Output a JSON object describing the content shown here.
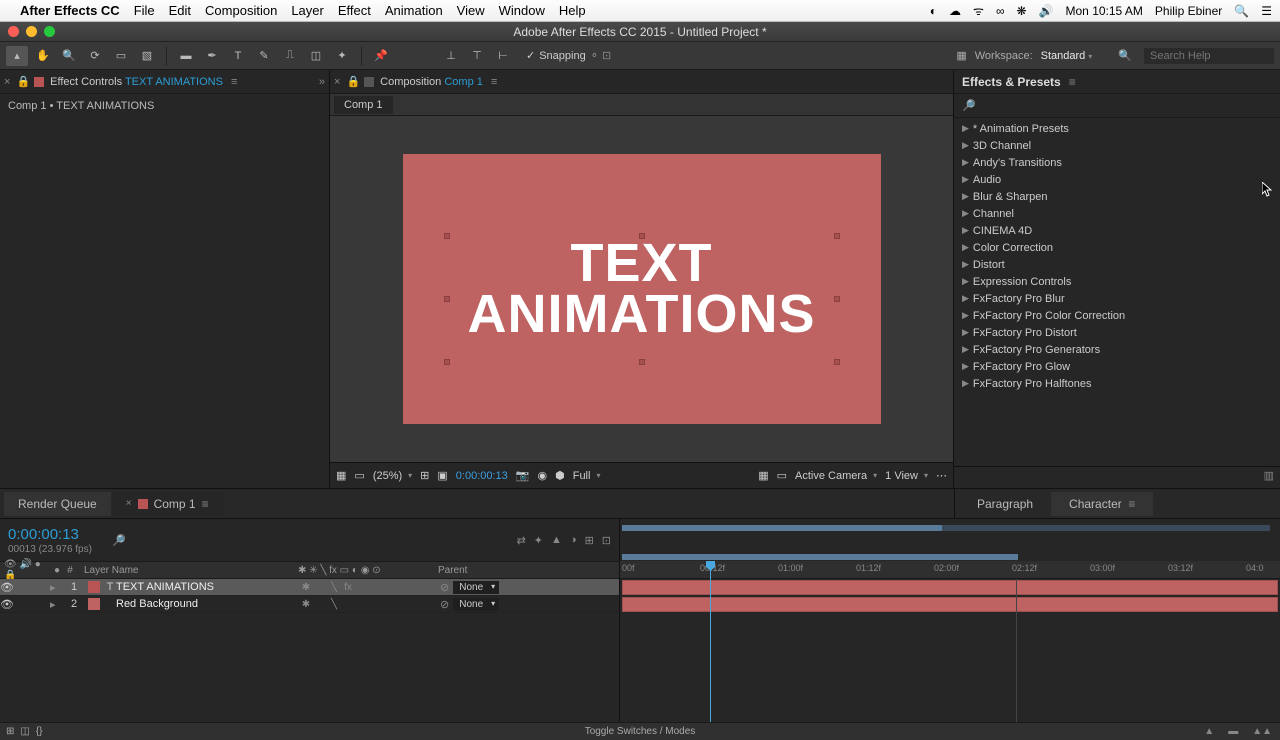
{
  "menubar": {
    "app": "After Effects CC",
    "items": [
      "File",
      "Edit",
      "Composition",
      "Layer",
      "Effect",
      "Animation",
      "View",
      "Window",
      "Help"
    ],
    "clock": "Mon 10:15 AM",
    "user": "Philip Ebiner"
  },
  "window_title": "Adobe After Effects CC 2015 - Untitled Project *",
  "toolbar": {
    "snapping": "Snapping"
  },
  "workspace": {
    "label": "Workspace:",
    "value": "Standard",
    "search_placeholder": "Search Help"
  },
  "effect_controls": {
    "title_prefix": "Effect Controls ",
    "title_layer": "TEXT ANIMATIONS",
    "breadcrumb": "Comp 1 • TEXT ANIMATIONS"
  },
  "composition_panel": {
    "title_prefix": "Composition ",
    "title_comp": "Comp 1",
    "tab": "Comp 1",
    "text_line1": "TEXT",
    "text_line2": "ANIMATIONS"
  },
  "viewer_bar": {
    "zoom": "(25%)",
    "timecode": "0:00:00:13",
    "resolution": "Full",
    "camera": "Active Camera",
    "views": "1 View"
  },
  "effects_presets": {
    "title": "Effects & Presets",
    "items": [
      "* Animation Presets",
      "3D Channel",
      "Andy's Transitions",
      "Audio",
      "Blur & Sharpen",
      "Channel",
      "CINEMA 4D",
      "Color Correction",
      "Distort",
      "Expression Controls",
      "FxFactory Pro Blur",
      "FxFactory Pro Color Correction",
      "FxFactory Pro Distort",
      "FxFactory Pro Generators",
      "FxFactory Pro Glow",
      "FxFactory Pro Halftones"
    ]
  },
  "char_panel": {
    "paragraph": "Paragraph",
    "character": "Character"
  },
  "bottom_tabs": {
    "render_queue": "Render Queue",
    "comp": "Comp 1"
  },
  "timeline": {
    "timecode": "0:00:00:13",
    "frames": "00013 (23.976 fps)",
    "col_layername": "Layer Name",
    "col_parent": "Parent",
    "layers": [
      {
        "idx": "1",
        "name": "TEXT ANIMATIONS",
        "parent": "None"
      },
      {
        "idx": "2",
        "name": "Red Background",
        "parent": "None"
      }
    ],
    "ruler": [
      "00f",
      "00:12f",
      "01:00f",
      "01:12f",
      "02:00f",
      "02:12f",
      "03:00f",
      "03:12f",
      "04:0"
    ],
    "footer": "Toggle Switches / Modes"
  }
}
